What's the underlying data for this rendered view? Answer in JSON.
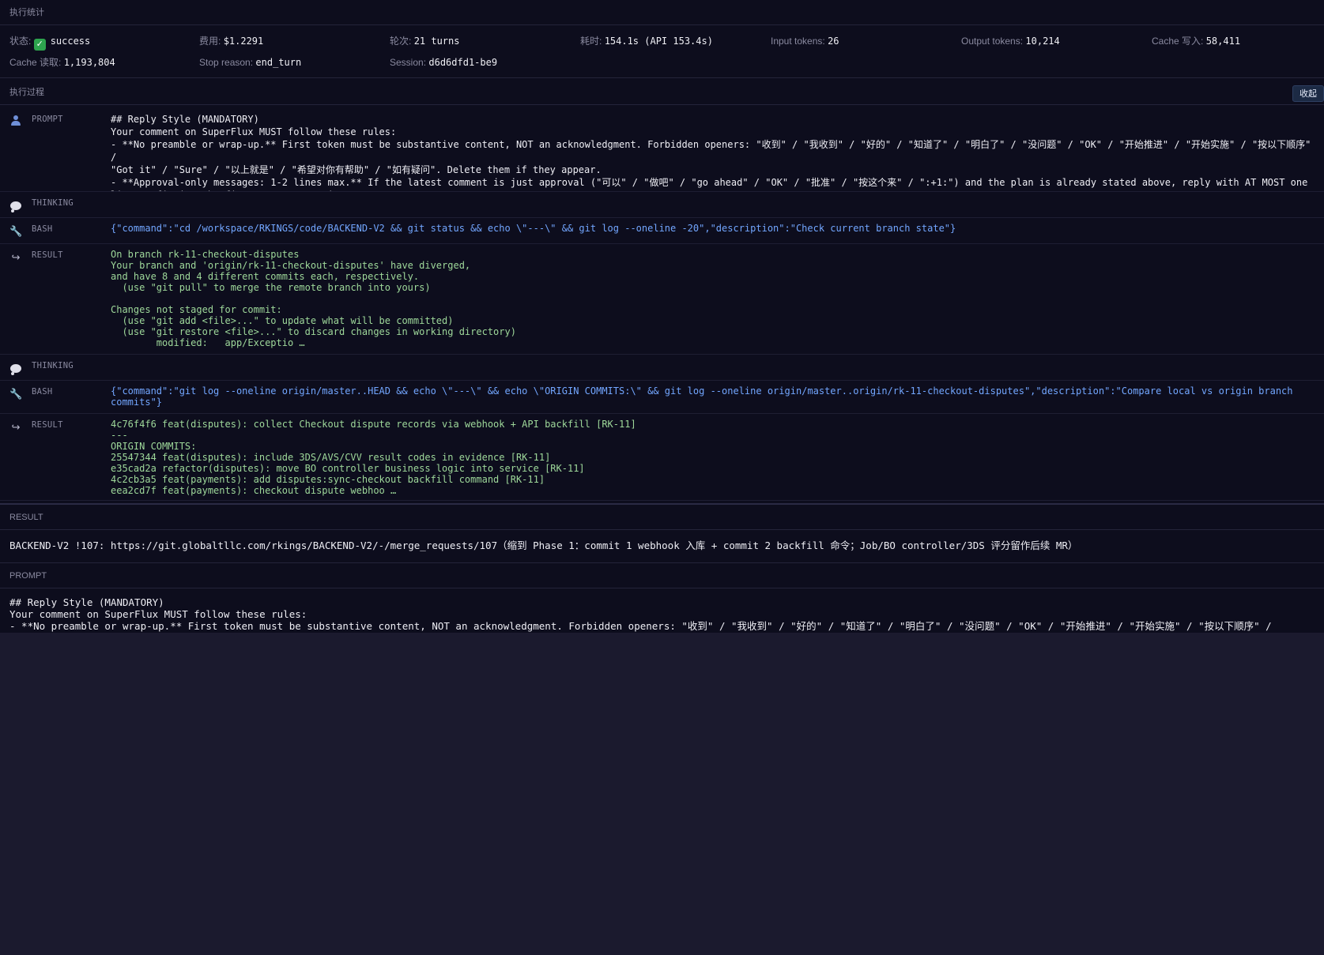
{
  "stats": {
    "title": "执行统计",
    "status_label": "状态:",
    "status_value": "success",
    "cost_label": "费用:",
    "cost_value": "$1.2291",
    "turns_label": "轮次:",
    "turns_value": "21 turns",
    "duration_label": "耗时:",
    "duration_value": "154.1s (API 153.4s)",
    "input_label": "Input tokens:",
    "input_value": "26",
    "output_label": "Output tokens:",
    "output_value": "10,214",
    "cache_write_label": "Cache 写入:",
    "cache_write_value": "58,411",
    "cache_read_label": "Cache 读取:",
    "cache_read_value": "1,193,804",
    "stop_label": "Stop reason:",
    "stop_value": "end_turn",
    "session_label": "Session:",
    "session_value": "d6d6dfd1-be9"
  },
  "process": {
    "title": "执行过程",
    "collapse_label": "收起",
    "entries": [
      {
        "kind": "PROMPT",
        "icon": "person-icon",
        "text": "## Reply Style (MANDATORY)\nYour comment on SuperFlux MUST follow these rules:\n- **No preamble or wrap-up.** First token must be substantive content, NOT an acknowledgment. Forbidden openers: \"收到\" / \"我收到\" / \"好的\" / \"知道了\" / \"明白了\" / \"没问题\" / \"OK\" / \"开始推进\" / \"开始实施\" / \"按以下顺序\" /\n\"Got it\" / \"Sure\" / \"以上就是\" / \"希望对你有帮助\" / \"如有疑问\". Delete them if they appear.\n- **Approval-only messages: 1-2 lines max.** If the latest comment is just approval (\"可以\" / \"做吧\" / \"go ahead\" / \"OK\" / \"批准\" / \"按这个来\" / \":+1:\") and the plan is already stated above, reply with AT MOST one\nline confirming the first concrete action. DO N …"
      },
      {
        "kind": "THINKING",
        "icon": "thought-bubble-icon",
        "text": ""
      },
      {
        "kind": "BASH",
        "icon": "wrench-icon",
        "text": "{\"command\":\"cd /workspace/RKINGS/code/BACKEND-V2 && git status && echo \\\"---\\\" && git log --oneline -20\",\"description\":\"Check current branch state\"}"
      },
      {
        "kind": "RESULT",
        "icon": "return-arrow-icon",
        "text": "On branch rk-11-checkout-disputes\nYour branch and 'origin/rk-11-checkout-disputes' have diverged,\nand have 8 and 4 different commits each, respectively.\n  (use \"git pull\" to merge the remote branch into yours)\n\nChanges not staged for commit:\n  (use \"git add <file>...\" to update what will be committed)\n  (use \"git restore <file>...\" to discard changes in working directory)\n        modified:   app/Exceptio …"
      },
      {
        "kind": "THINKING",
        "icon": "thought-bubble-icon",
        "text": ""
      },
      {
        "kind": "BASH",
        "icon": "wrench-icon",
        "text": "{\"command\":\"git log --oneline origin/master..HEAD && echo \\\"---\\\" && echo \\\"ORIGIN COMMITS:\\\" && git log --oneline origin/master..origin/rk-11-checkout-disputes\",\"description\":\"Compare local vs origin branch\ncommits\"}"
      },
      {
        "kind": "RESULT",
        "icon": "return-arrow-icon",
        "text": "4c76f4f6 feat(disputes): collect Checkout dispute records via webhook + API backfill [RK-11]\n---\nORIGIN COMMITS:\n25547344 feat(disputes): include 3DS/AVS/CVV result codes in evidence [RK-11]\ne35cad2a refactor(disputes): move BO controller business logic into service [RK-11]\n4c2cb3a5 feat(payments): add disputes:sync-checkout backfill command [RK-11]\neea2cd7f feat(payments): checkout dispute webhoo …"
      }
    ]
  },
  "result": {
    "title": "RESULT",
    "text": "BACKEND-V2 !107: https://git.globaltllc.com/rkings/BACKEND-V2/-/merge_requests/107（缩到 Phase 1：commit 1 webhook 入库 + commit 2 backfill 命令；Job/BO controller/3DS 评分留作后续 MR）"
  },
  "prompt": {
    "title": "PROMPT",
    "text": "## Reply Style (MANDATORY)\nYour comment on SuperFlux MUST follow these rules:\n- **No preamble or wrap-up.** First token must be substantive content, NOT an acknowledgment. Forbidden openers: \"收到\" / \"我收到\" / \"好的\" / \"知道了\" / \"明白了\" / \"没问题\" / \"OK\" / \"开始推进\" / \"开始实施\" / \"按以下顺序\" /"
  }
}
